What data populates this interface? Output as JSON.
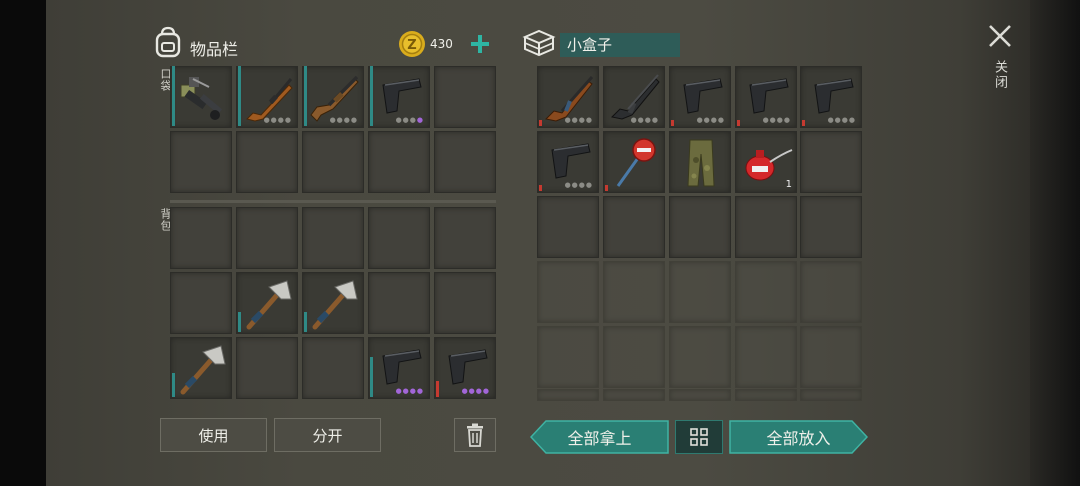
{
  "inventory": {
    "title": "物品栏",
    "coins": "430",
    "pocket_label": "口袋",
    "backpack_label": "背包",
    "use_label": "使用",
    "split_label": "分开"
  },
  "container": {
    "name": "小盒子",
    "take_all_label": "全部拿上",
    "put_all_label": "全部放入",
    "item_count": "1"
  },
  "close_label": "关闭",
  "colors": {
    "accent_teal": "#2a8c7f",
    "durability_teal": "#2f8a86",
    "durability_red": "#c53a30",
    "rarity_purple": "#a266d8",
    "coin_gold": "#d9ac1c"
  },
  "icons": {
    "backpack": "backpack-icon",
    "coin": "coin-icon",
    "add": "plus-icon",
    "box": "box-icon",
    "close": "close-icon",
    "trash": "trash-icon",
    "grid": "grid-icon"
  },
  "items": {
    "pocket": [
      "mounted-gun-icon",
      "rifle-icon",
      "shotgun-icon",
      "pistol-icon"
    ],
    "backpack": [
      "hatchet-icon",
      "hatchet-icon",
      "hatchet-icon",
      "pistol-icon",
      "pistol-icon"
    ],
    "container": [
      "ak-rifle-icon",
      "assault-rifle-icon",
      "pistol-icon",
      "pistol-icon",
      "pistol-icon",
      "pistol-icon",
      "stop-sign-icon",
      "pants-icon",
      "oil-can-icon"
    ]
  }
}
